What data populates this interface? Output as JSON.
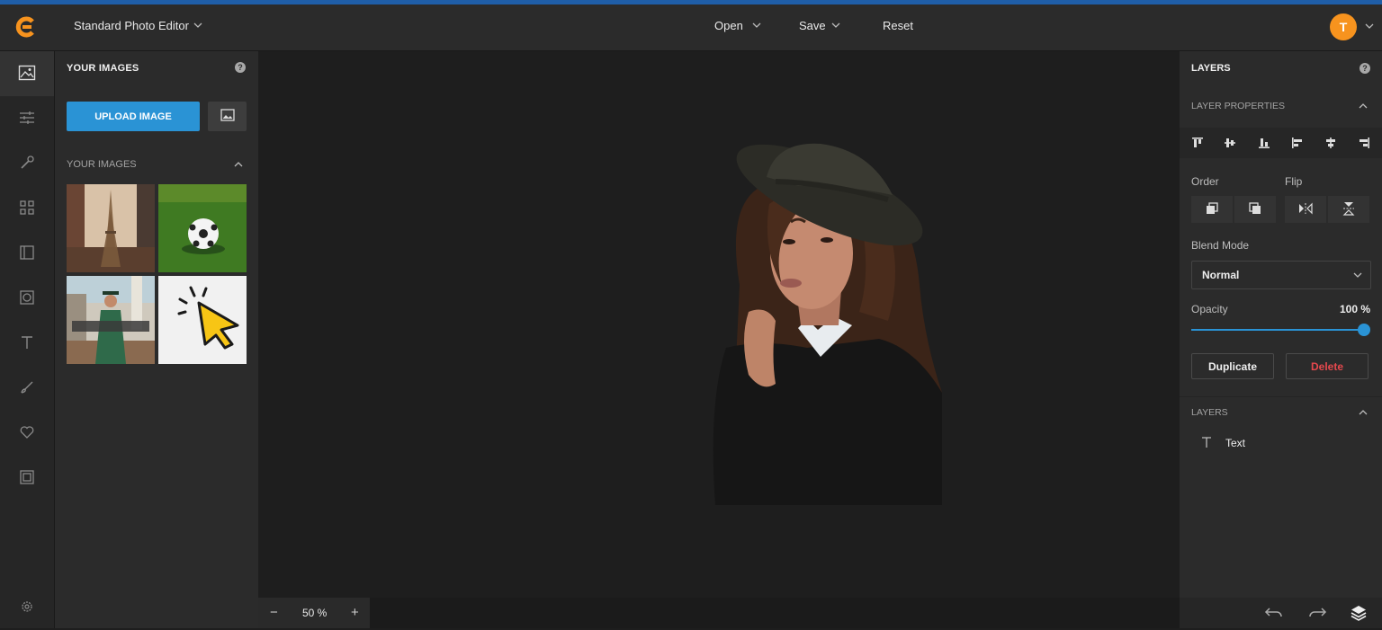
{
  "header": {
    "app_title": "Standard Photo Editor",
    "menu": {
      "open": "Open",
      "save": "Save",
      "reset": "Reset"
    },
    "avatar_initial": "T"
  },
  "rail": {
    "items": [
      "image-icon",
      "adjust-sliders-icon",
      "magic-wand-icon",
      "grid-icon",
      "panel-icon",
      "circle-frame-icon",
      "text-icon",
      "brush-icon",
      "heart-icon",
      "frame-icon",
      "settings-icon"
    ]
  },
  "images_panel": {
    "heading": "YOUR IMAGES",
    "help": "?",
    "upload_label": "UPLOAD IMAGE",
    "section_label": "YOUR IMAGES",
    "thumbnails": [
      "eiffel-tower-photo",
      "soccer-ball-photo",
      "graduate-photo",
      "cursor-click-graphic"
    ]
  },
  "zoom": {
    "minus": "−",
    "value": "50 %",
    "plus": "+"
  },
  "layers_panel": {
    "title": "LAYERS",
    "help": "?",
    "properties_label": "LAYER PROPERTIES",
    "order_label": "Order",
    "flip_label": "Flip",
    "blend_label": "Blend Mode",
    "blend_value": "Normal",
    "opacity_label": "Opacity",
    "opacity_value": "100 %",
    "opacity": 1.0,
    "duplicate_label": "Duplicate",
    "delete_label": "Delete",
    "layers_section_label": "LAYERS",
    "layers": [
      {
        "type": "text",
        "label": "Text"
      }
    ]
  },
  "colors": {
    "accent": "#2a93d5",
    "avatar": "#f7931e",
    "delete": "#e5484d",
    "logo": "#f7931e"
  }
}
